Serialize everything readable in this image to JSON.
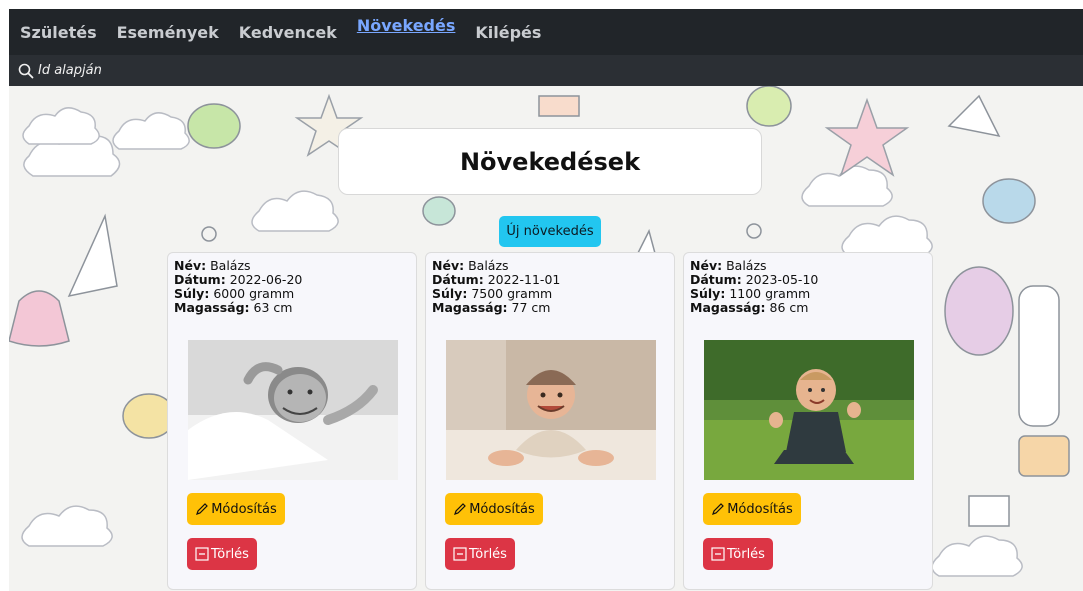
{
  "nav": {
    "items": [
      {
        "label": "Születés"
      },
      {
        "label": "Események"
      },
      {
        "label": "Kedvencek"
      },
      {
        "label": "Növekedés",
        "active": true
      },
      {
        "label": "Kilépés"
      }
    ]
  },
  "search": {
    "placeholder": "Id alapján",
    "icon": "search-icon"
  },
  "page": {
    "title": "Növekedések",
    "new_button": "Új növekedés"
  },
  "labels": {
    "name": "Név:",
    "date": "Dátum:",
    "weight": "Súly:",
    "height": "Magasság:"
  },
  "cards": [
    {
      "name": "Balázs",
      "date": "2022-06-20",
      "weight": "6000 gramm",
      "height": "63 cm",
      "photo": "baby-lying-black-and-white"
    },
    {
      "name": "Balázs",
      "date": "2022-11-01",
      "weight": "7500 gramm",
      "height": "77 cm",
      "photo": "baby-crawling-on-rug"
    },
    {
      "name": "Balázs",
      "date": "2023-05-10",
      "weight": "1100 gramm",
      "height": "86 cm",
      "photo": "toddler-sitting-on-grass"
    }
  ],
  "actions": {
    "edit": "Módosítás",
    "delete": "Törlés",
    "edit_icon": "pencil-icon",
    "delete_icon": "dash-square-icon"
  },
  "colors": {
    "navbar": "#212529",
    "active_link": "#79a7ff",
    "info_button": "#22c6f0",
    "warning_button": "#ffc107",
    "danger_button": "#dc3545"
  }
}
